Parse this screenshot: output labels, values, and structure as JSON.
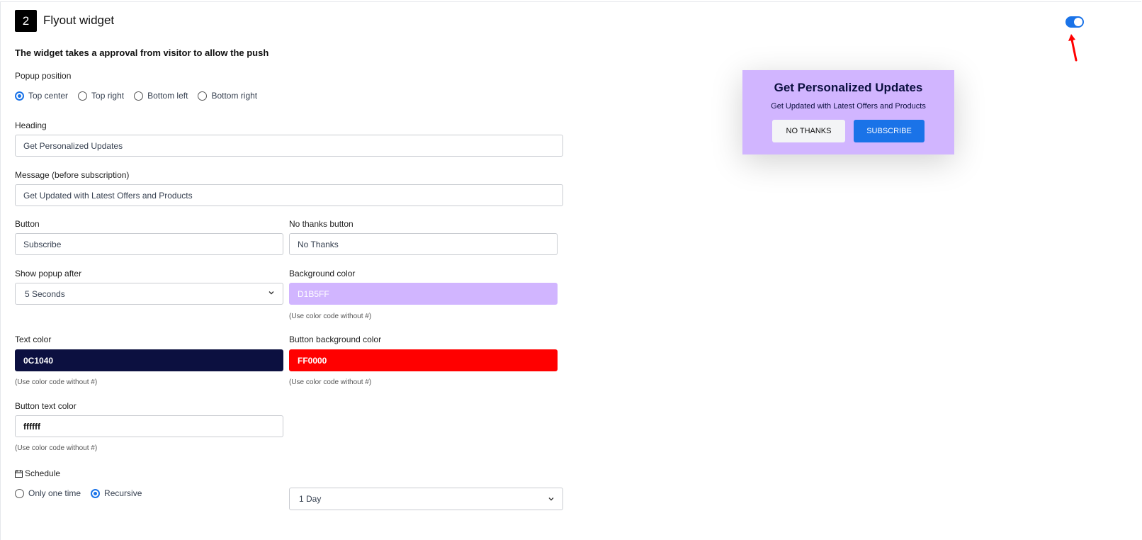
{
  "section": {
    "step_number": "2",
    "title": "Flyout widget",
    "description": "The widget takes a approval from visitor to allow the push",
    "enabled": true
  },
  "popup_position": {
    "label": "Popup position",
    "options": [
      "Top center",
      "Top right",
      "Bottom left",
      "Bottom right"
    ],
    "selected": "Top center"
  },
  "fields": {
    "heading": {
      "label": "Heading",
      "value": "Get Personalized Updates"
    },
    "message": {
      "label": "Message (before subscription)",
      "value": "Get Updated with Latest Offers and Products"
    },
    "button": {
      "label": "Button",
      "value": "Subscribe"
    },
    "no_thanks": {
      "label": "No thanks button",
      "value": "No Thanks"
    },
    "show_after": {
      "label": "Show popup after",
      "value": "5 Seconds"
    },
    "background_color": {
      "label": "Background color",
      "value": "D1B5FF",
      "hint": "(Use color code without #)"
    },
    "text_color": {
      "label": "Text color",
      "value": "0C1040",
      "hint": "(Use color code without #)"
    },
    "button_bg_color": {
      "label": "Button background color",
      "value": "FF0000",
      "hint": "(Use color code without #)"
    },
    "button_text_color": {
      "label": "Button text color",
      "value": "ffffff",
      "hint": "(Use color code without #)"
    }
  },
  "schedule": {
    "label": "Schedule",
    "options": [
      "Only one time",
      "Recursive"
    ],
    "selected": "Recursive",
    "interval": "1 Day"
  },
  "preview": {
    "heading": "Get Personalized Updates",
    "message": "Get Updated with Latest Offers and Products",
    "no_thanks_label": "NO THANKS",
    "subscribe_label": "SUBSCRIBE"
  },
  "colors": {
    "preview_bg": "#D1B5FF",
    "text": "#0C1040",
    "button_bg": "#FF0000",
    "accent": "#1a73e8",
    "annotation_arrow": "#ff0000"
  }
}
